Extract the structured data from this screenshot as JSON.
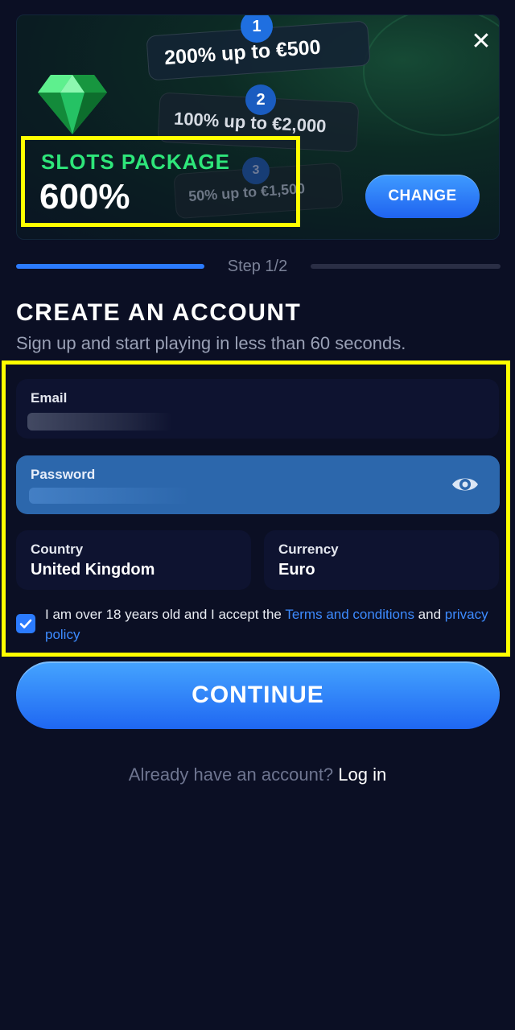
{
  "banner": {
    "close_symbol": "✕",
    "offers": [
      {
        "number": "1",
        "text": "200% up to €500"
      },
      {
        "number": "2",
        "text": "100% up to €2,000"
      },
      {
        "number": "3",
        "text": "50% up to €1,500"
      }
    ],
    "package_title": "SLOTS PACKAGE",
    "package_value": "600%",
    "change_label": "CHANGE",
    "colors": {
      "accent_green": "#2ee67a",
      "highlight": "#ffff00",
      "button_blue": "#1f63f0"
    }
  },
  "progress": {
    "step_label": "Step 1/2",
    "fraction": 0.5
  },
  "form": {
    "heading": "CREATE AN ACCOUNT",
    "subheading": "Sign up and start playing in less than 60 seconds.",
    "email": {
      "label": "Email"
    },
    "password": {
      "label": "Password",
      "icon": "eye-icon"
    },
    "country": {
      "label": "Country",
      "value": "United Kingdom"
    },
    "currency": {
      "label": "Currency",
      "value": "Euro"
    },
    "terms": {
      "checked": true,
      "prefix": "I am over 18 years old and I accept the ",
      "terms_link": "Terms and conditions",
      "middle": " and ",
      "privacy_link": "privacy policy"
    },
    "continue_label": "CONTINUE"
  },
  "footer": {
    "prompt": "Already have an account? ",
    "login_link": "Log in"
  }
}
